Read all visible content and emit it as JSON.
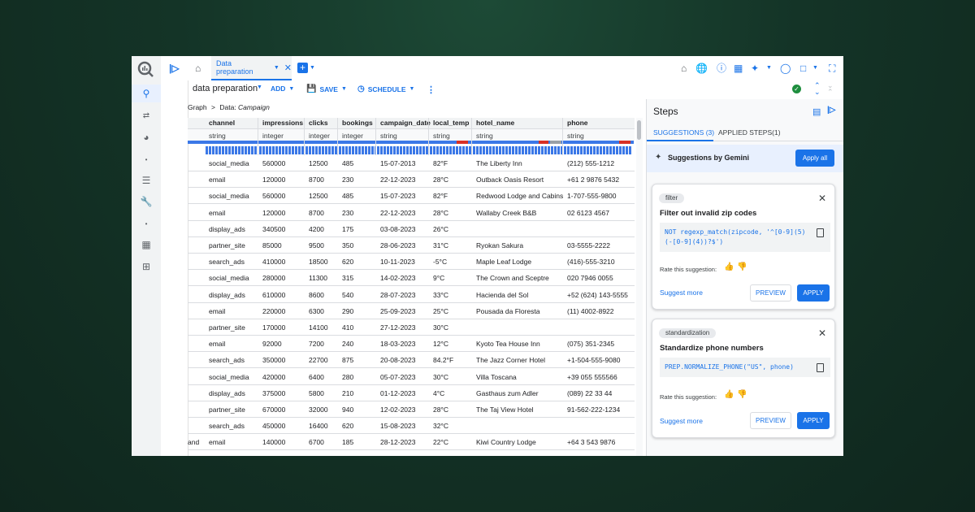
{
  "tab": {
    "label": "Data preparation"
  },
  "toolbar": {
    "name": "data preparation",
    "add": "ADD",
    "save": "SAVE",
    "schedule": "SCHEDULE"
  },
  "breadcrumb": {
    "root": "Graph",
    "sep": ">",
    "prefix": "Data:",
    "item": "Campaign"
  },
  "columns": [
    "channel",
    "impressions",
    "clicks",
    "bookings",
    "campaign_date",
    "local_temp",
    "hotel_name",
    "phone"
  ],
  "types": [
    "string",
    "integer",
    "integer",
    "integer",
    "string",
    "string",
    "string",
    "string"
  ],
  "rows": [
    [
      "social_media",
      "560000",
      "12500",
      "485",
      "15-07-2013",
      "82°F",
      "The Liberty Inn",
      "(212) 555-1212"
    ],
    [
      "email",
      "120000",
      "8700",
      "230",
      "22-12-2023",
      "28°C",
      "Outback Oasis Resort",
      "+61 2 9876 5432"
    ],
    [
      "social_media",
      "560000",
      "12500",
      "485",
      "15-07-2023",
      "82°F",
      "Redwood Lodge and Cabins",
      "1-707-555-9800"
    ],
    [
      "email",
      "120000",
      "8700",
      "230",
      "22-12-2023",
      "28°C",
      "Wallaby Creek B&B",
      "02 6123 4567"
    ],
    [
      "display_ads",
      "340500",
      "4200",
      "175",
      "03-08-2023",
      "26°C",
      "",
      ""
    ],
    [
      "partner_site",
      "85000",
      "9500",
      "350",
      "28-06-2023",
      "31°C",
      "Ryokan Sakura",
      "03-5555-2222"
    ],
    [
      "search_ads",
      "410000",
      "18500",
      "620",
      "10-11-2023",
      "-5°C",
      "Maple Leaf Lodge",
      "(416)-555-3210"
    ],
    [
      "social_media",
      "280000",
      "11300",
      "315",
      "14-02-2023",
      "9°C",
      "The Crown and Sceptre",
      "020 7946 0055"
    ],
    [
      "display_ads",
      "610000",
      "8600",
      "540",
      "28-07-2023",
      "33°C",
      "Hacienda del Sol",
      "+52 (624) 143-5555"
    ],
    [
      "email",
      "220000",
      "6300",
      "290",
      "25-09-2023",
      "25°C",
      "Pousada da Floresta",
      "(11) 4002-8922"
    ],
    [
      "partner_site",
      "170000",
      "14100",
      "410",
      "27-12-2023",
      "30°C",
      "",
      ""
    ],
    [
      "email",
      "92000",
      "7200",
      "240",
      "18-03-2023",
      "12°C",
      "Kyoto Tea House Inn",
      "(075) 351-2345"
    ],
    [
      "search_ads",
      "350000",
      "22700",
      "875",
      "20-08-2023",
      "84.2°F",
      "The Jazz Corner Hotel",
      "+1-504-555-9080"
    ],
    [
      "social_media",
      "420000",
      "6400",
      "280",
      "05-07-2023",
      "30°C",
      "Villa Toscana",
      "+39 055 555566"
    ],
    [
      "display_ads",
      "375000",
      "5800",
      "210",
      "01-12-2023",
      "4°C",
      "Gasthaus zum Adler",
      "(089) 22 33 44"
    ],
    [
      "partner_site",
      "670000",
      "32000",
      "940",
      "12-02-2023",
      "28°C",
      "The Taj View Hotel",
      "91-562-222-1234"
    ],
    [
      "search_ads",
      "450000",
      "16400",
      "620",
      "15-08-2023",
      "32°C",
      "",
      ""
    ],
    [
      "email",
      "140000",
      "6700",
      "185",
      "28-12-2023",
      "22°C",
      "Kiwi Country Lodge",
      "+64 3 543 9876"
    ]
  ],
  "row_prefix_partial": "and",
  "steps": {
    "title": "Steps",
    "tab_suggestions": "SUGGESTIONS (3)",
    "tab_applied": "APPLIED STEPS(1)",
    "gemini_label": "Suggestions by Gemini",
    "apply_all": "Apply all",
    "cards": [
      {
        "chip": "filter",
        "title": "Filter out invalid zip codes",
        "code": "NOT regexp_match(zipcode, '^[0-9](5)(-[0-9](4))?$')",
        "rate": "Rate this suggestion:",
        "more": "Suggest more",
        "preview": "PREVIEW",
        "apply": "APPLY"
      },
      {
        "chip": "standardization",
        "title": "Standardize phone numbers",
        "code": "PREP.NORMALIZE_PHONE(\"US\", phone)",
        "rate": "Rate this suggestion:",
        "more": "Suggest more",
        "preview": "PREVIEW",
        "apply": "APPLY"
      }
    ]
  },
  "colors": {
    "accent": "#1a73e8",
    "bar": "#3b78e7",
    "error": "#d93025",
    "ok": "#1e8e3e"
  }
}
